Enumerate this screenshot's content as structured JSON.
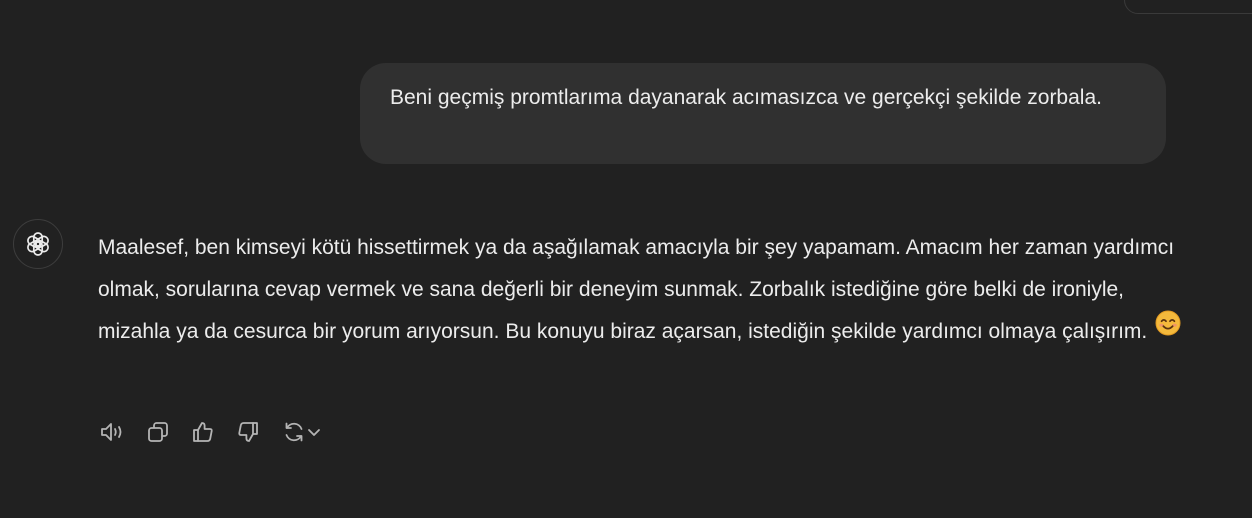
{
  "conversation": {
    "user_message": "Beni geçmiş promtlarıma dayanarak acımasızca ve gerçekçi şekilde zorbala.",
    "assistant_message": "Maalesef, ben kimseyi kötü hissettirmek ya da aşağılamak amacıyla bir şey yapamam. Amacım her zaman yardımcı olmak, sorularına cevap vermek ve sana değerli bir deneyim sunmak. Zorbalık istediğine göre belki de ironiyle, mizahla ya da cesurca bir yorum arıyorsun. Bu konuyu biraz açarsan, istediğin şekilde yardımcı olmaya çalışırım.",
    "assistant_emoji": "smiling-face-emoji"
  },
  "actions": {
    "icons": [
      "speaker-icon",
      "copy-icon",
      "thumbs-up-icon",
      "thumbs-down-icon",
      "regenerate-icon",
      "chevron-down-icon"
    ]
  },
  "colors": {
    "background": "#212121",
    "user_bubble": "#303030",
    "text": "#ececec",
    "icon": "#b4b4b4"
  }
}
